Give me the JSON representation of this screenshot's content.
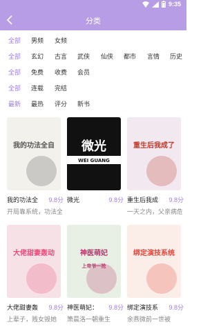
{
  "status": {
    "time": "9:35"
  },
  "header": {
    "title": "分类",
    "back_icon": "chevron-left-icon"
  },
  "filters": [
    {
      "items": [
        "全部",
        "男频",
        "女频"
      ],
      "active": 0
    },
    {
      "items": [
        "全部",
        "玄幻",
        "古言",
        "武侠",
        "仙侠",
        "都市",
        "言情",
        "历史"
      ],
      "active": 0
    },
    {
      "items": [
        "全部",
        "免费",
        "收费",
        "会员"
      ],
      "active": 0
    },
    {
      "items": [
        "全部",
        "连载",
        "完结"
      ],
      "active": 0
    },
    {
      "items": [
        "最新",
        "最热",
        "评分",
        "新书"
      ],
      "active": 0
    }
  ],
  "books": [
    {
      "name": "我的功法全",
      "score": "9.8分",
      "desc": "开局靠系统，功法全自动",
      "cover_title": "我的功法全自动",
      "cover_bg": "#f3f1ec"
    },
    {
      "name": "微光",
      "score": "9.8分",
      "desc": "",
      "cover_title": "微光",
      "cover_sub": "WEI GUANG",
      "cover_bg": "#111111"
    },
    {
      "name": "重生后我成",
      "score": "9.8分",
      "desc": "一天之内，父亲病危",
      "cover_title": "重生后我成了王爷心尖宠",
      "cover_bg": "#f2e8ef"
    },
    {
      "name": "大佬甜妻轰",
      "score": "9.8分",
      "desc": "上辈子，贱女毁她",
      "cover_title": "大佬甜妻轰动全城",
      "cover_bg": "#f6e2e6"
    },
    {
      "name": "神医萌妃：",
      "score": "9.8分",
      "desc": "箫晨洛一朝重生",
      "cover_title": "神医萌妃",
      "cover_sub": "上帝爷一抢",
      "cover_bg": "#e8f0e6"
    },
    {
      "name": "绑定演技系",
      "score": "9.8分",
      "desc": "余燕微前一世被",
      "cover_title": "绑定演技系统后我爆红了",
      "cover_bg": "#fbeee8"
    }
  ]
}
